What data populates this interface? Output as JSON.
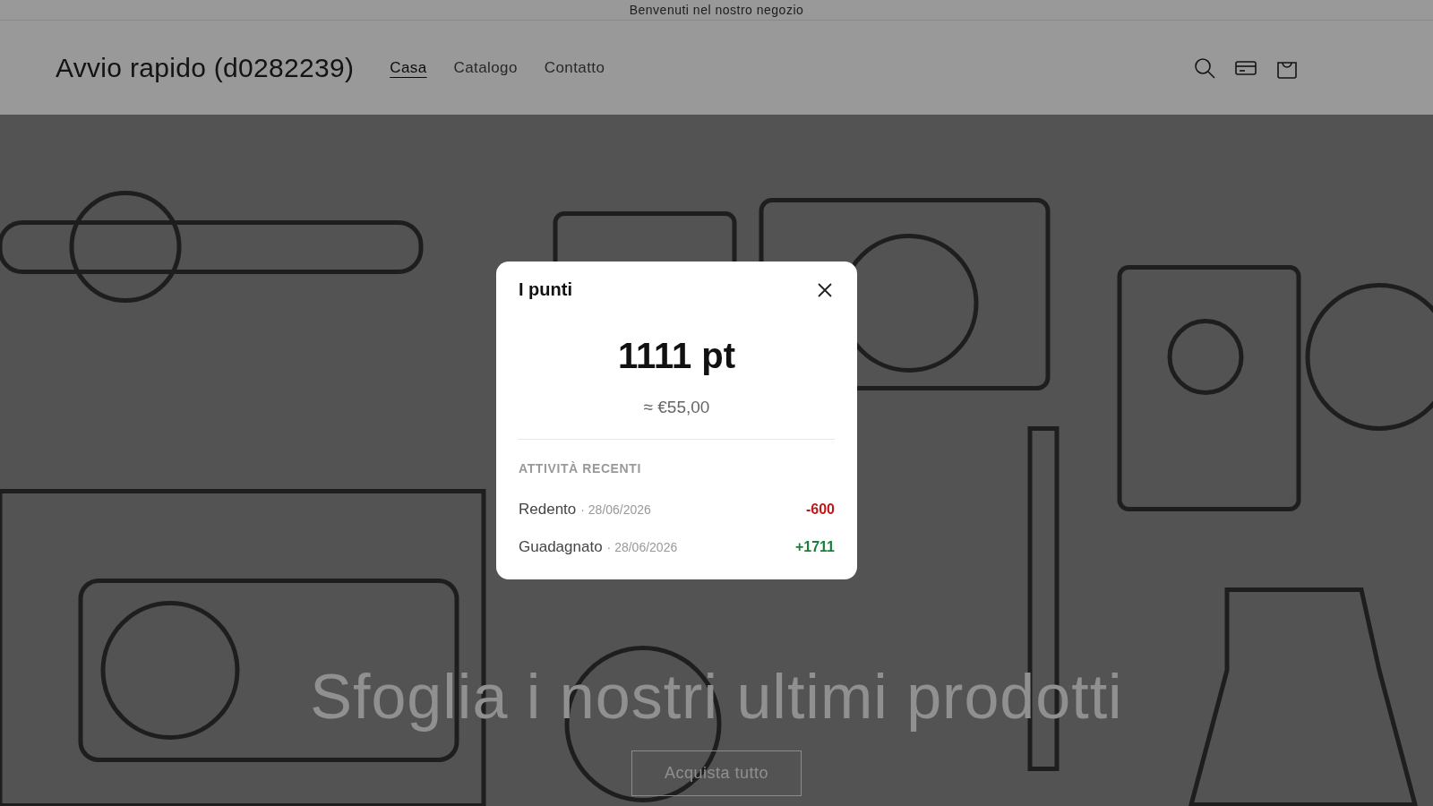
{
  "announcement": {
    "text": "Benvenuti nel nostro negozio"
  },
  "header": {
    "logo": "Avvio rapido (d0282239)",
    "nav": [
      {
        "label": "Casa",
        "selected": true
      },
      {
        "label": "Catalogo",
        "selected": false
      },
      {
        "label": "Contatto",
        "selected": false
      }
    ]
  },
  "hero": {
    "kind": "picture",
    "heading": "Sfoglia i nostri ultimi prodotti",
    "button": "Acquista tutto"
  },
  "points_modal": {
    "title": "I punti",
    "balance": "1111 pt",
    "value": "≈ €55,00",
    "section_title": "ATTIVITÀ RECENTI",
    "activity": [
      {
        "label": "Redento",
        "date": "· 28/06/2026",
        "amount": "-600",
        "kind": "debit"
      },
      {
        "label": "Guadagnato",
        "date": "· 28/06/2026",
        "amount": "+1711",
        "kind": "credit"
      }
    ]
  }
}
